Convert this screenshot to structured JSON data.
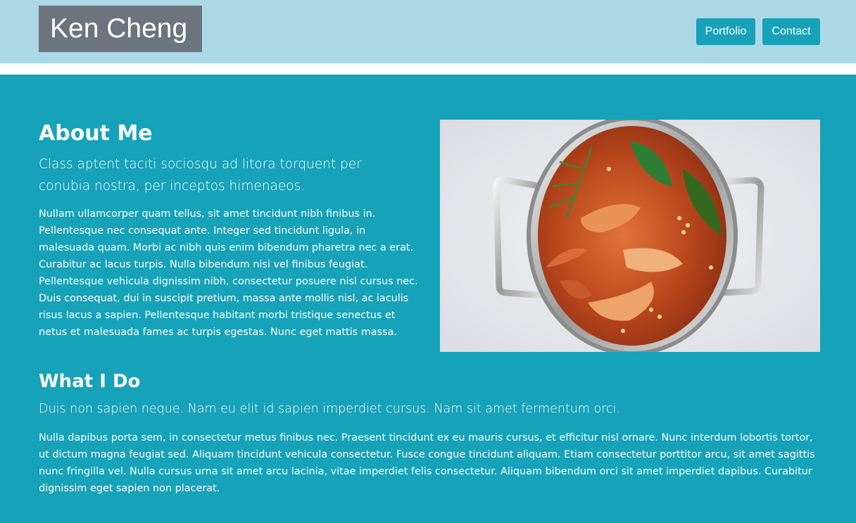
{
  "header": {
    "logo": "Ken Cheng",
    "nav": [
      {
        "label": "Portfolio"
      },
      {
        "label": "Contact"
      }
    ]
  },
  "about": {
    "title": "About Me",
    "lead": "Class aptent taciti sociosqu ad litora torquent per conubia nostra, per inceptos himenaeos.",
    "body": "Nullam ullamcorper quam tellus, sit amet tincidunt nibh finibus in. Pellentesque nec consequat ante. Integer sed tincidunt ligula, in malesuada quam. Morbi ac nibh quis enim bibendum pharetra nec a erat. Curabitur ac lacus turpis. Nulla bibendum nisi vel finibus feugiat. Pellentesque vehicula dignissim nibh, consectetur posuere nisl cursus nec. Duis consequat, dui in suscipit pretium, massa ante mollis nisl, ac iaculis risus lacus a sapien. Pellentesque habitant morbi tristique senectus et netus et malesuada fames ac turpis egestas. Nunc eget mattis massa.",
    "image_icon": "soup-pot-photo"
  },
  "what": {
    "title": "What I Do",
    "lead": "Duis non sapien neque. Nam eu elit id sapien imperdiet cursus. Nam sit amet fermentum orci.",
    "body": "Nulla dapibus porta sem, in consectetur metus finibus nec. Praesent tincidunt ex eu mauris cursus, et efficitur nisl ornare. Nunc interdum lobortis tortor, ut dictum magna feugiat sed. Aliquam tincidunt vehicula consectetur. Fusce congue tincidunt aliquam. Etiam consectetur porttitor arcu, sit amet sagittis nunc fringilla vel. Nulla cursus urna sit amet arcu lacinia, vitae imperdiet felis consectetur. Aliquam bibendum orci sit amet imperdiet dapibus. Curabitur dignissim eget sapien non placerat."
  },
  "colors": {
    "header_bg": "#add8e6",
    "logo_bg": "#6c757d",
    "accent": "#17a2b8",
    "main_bg": "#16a2b8"
  }
}
